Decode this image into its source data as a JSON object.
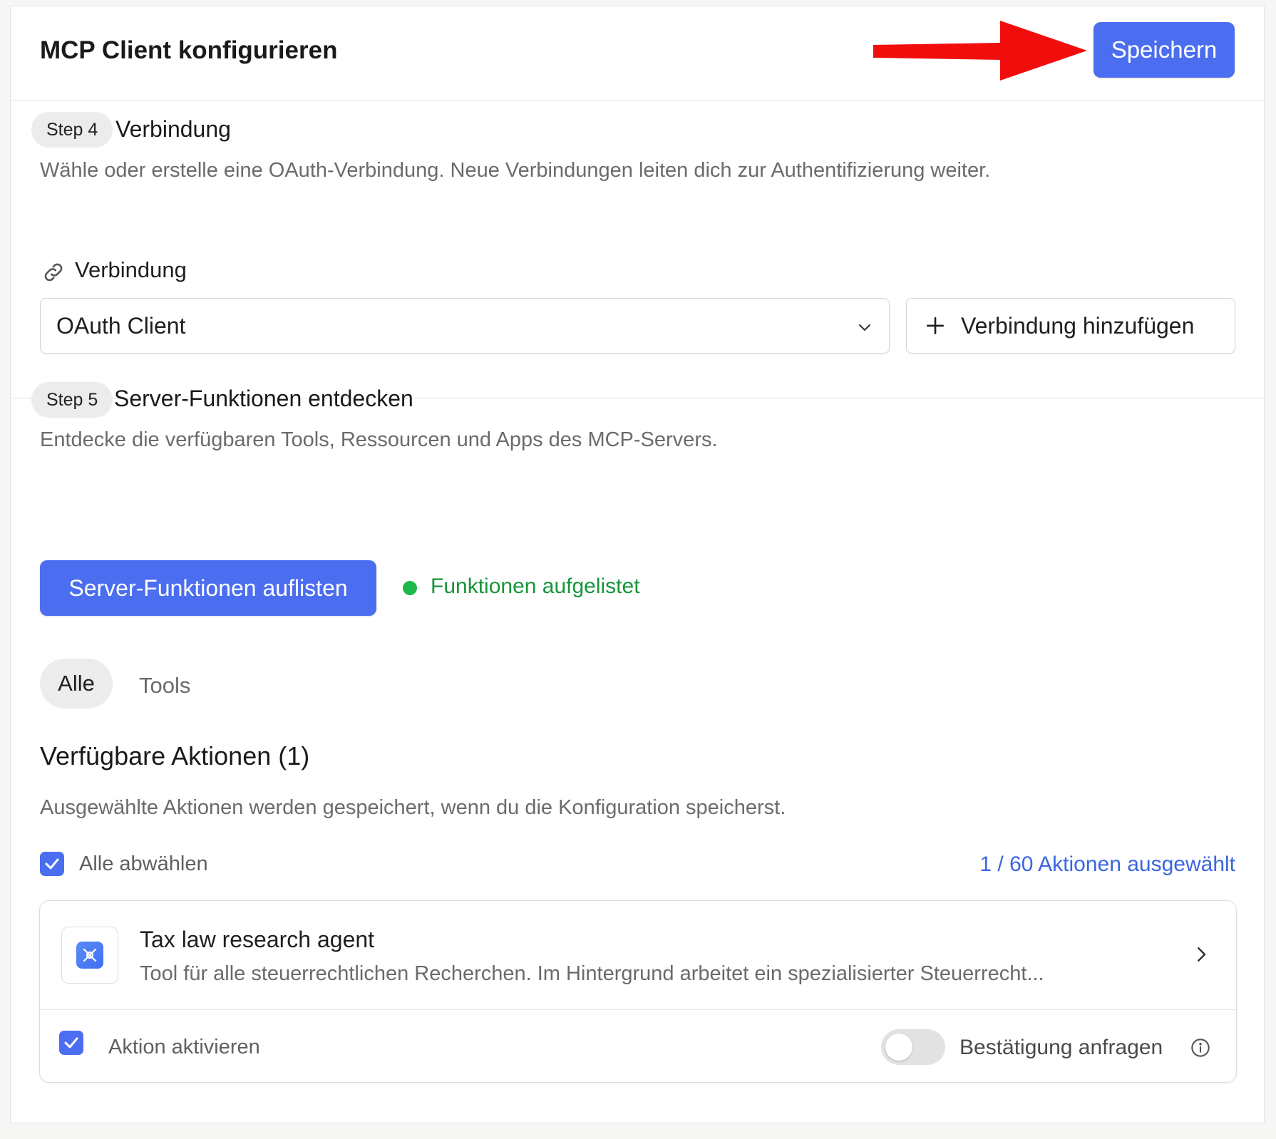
{
  "header": {
    "title": "MCP Client konfigurieren",
    "save_label": "Speichern"
  },
  "step4": {
    "badge": "Step 4",
    "title": "Verbindung",
    "description": "Wähle oder erstelle eine OAuth-Verbindung. Neue Verbindungen leiten dich zur Authentifizierung weiter.",
    "field_label": "Verbindung",
    "selected_connection": "OAuth Client",
    "add_connection_label": "Verbindung hinzufügen"
  },
  "step5": {
    "badge": "Step 5",
    "title": "Server-Funktionen entdecken",
    "description": "Entdecke die verfügbaren Tools, Ressourcen und Apps des MCP-Servers.",
    "list_button_label": "Server-Funktionen auflisten",
    "status_text": "Funktionen aufgelistet",
    "tabs": [
      {
        "label": "Alle",
        "active": true
      },
      {
        "label": "Tools",
        "active": false
      }
    ]
  },
  "actions": {
    "title": "Verfügbare Aktionen (1)",
    "description": "Ausgewählte Aktionen werden gespeichert, wenn du die Konfiguration speicherst.",
    "deselect_all_label": "Alle abwählen",
    "deselect_all_checked": true,
    "count_label": "1 / 60 Aktionen ausgewählt",
    "items": [
      {
        "icon": "tool-icon",
        "name": "Tax law research agent",
        "description": "Tool für alle steuerrechtlichen Recherchen. Im Hintergrund arbeitet ein spezialisierter Steuerrecht...",
        "enable_label": "Aktion aktivieren",
        "enabled": true,
        "confirm_label": "Bestätigung anfragen",
        "confirm_on": false
      }
    ]
  },
  "colors": {
    "primary": "#4b6df0",
    "status_green": "#17953a",
    "annotation_arrow": "#f20d0d"
  }
}
